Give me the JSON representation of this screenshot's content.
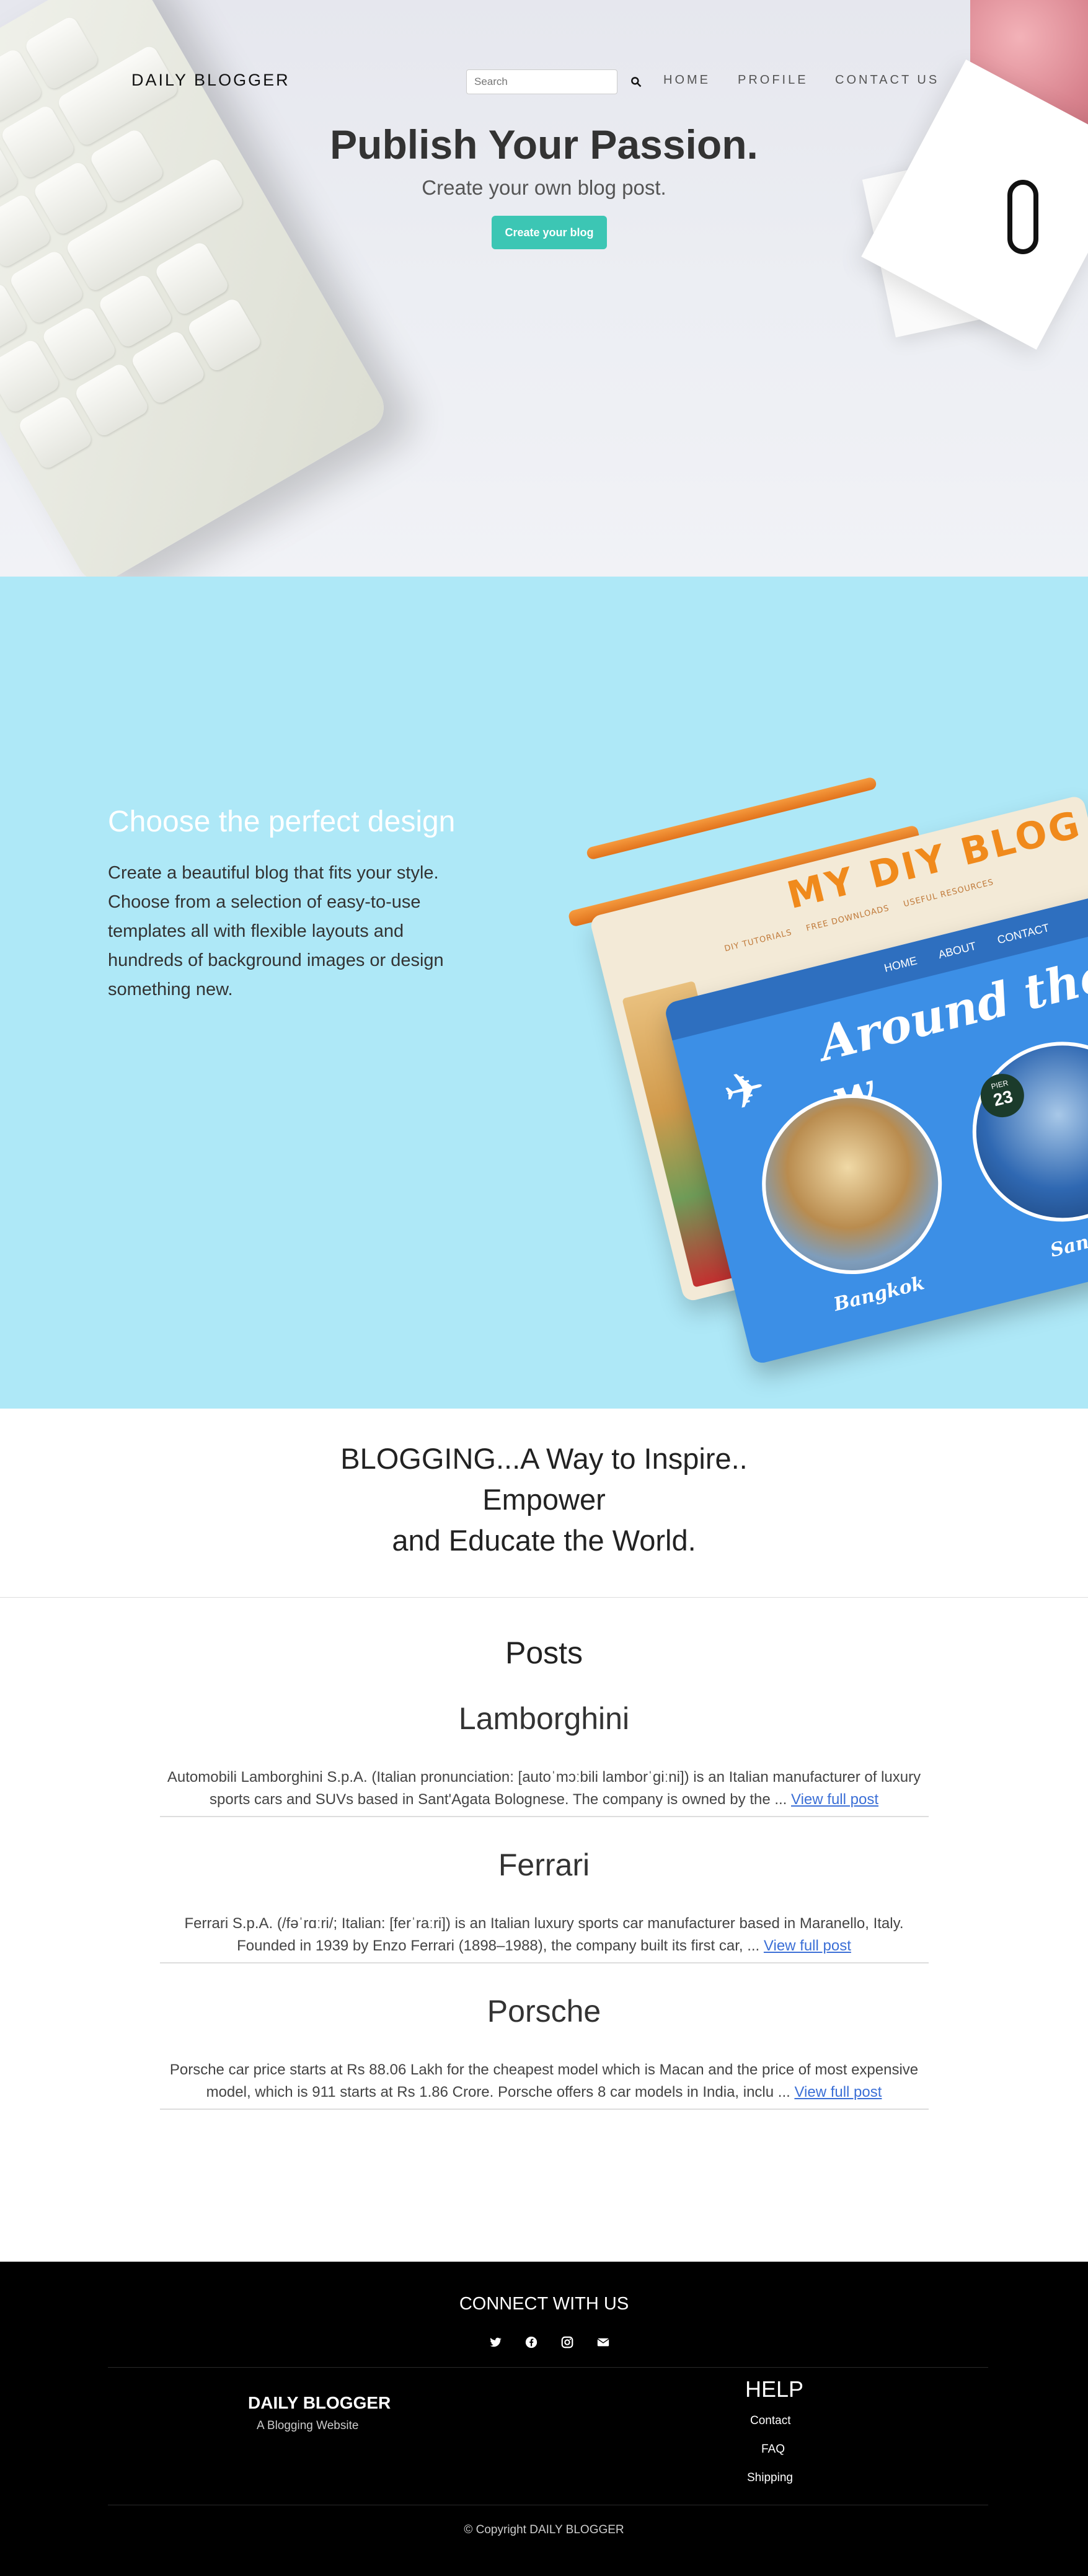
{
  "nav": {
    "brand": "DAILY BLOGGER",
    "search_placeholder": "Search",
    "links": [
      "HOME",
      "PROFILE",
      "CONTACT US"
    ]
  },
  "hero": {
    "title": "Publish Your Passion.",
    "subtitle": "Create your own blog post.",
    "button": "Create your blog"
  },
  "design": {
    "heading": "Choose the perfect design",
    "text": "Create a beautiful blog that fits your style. Choose from a selection of easy-to-use templates all with flexible layouts and hundreds of background images or design something new.",
    "art": {
      "blog_title": "MY DIY BLOG",
      "menu": [
        "DIY TUTORIALS",
        "FREE DOWNLOADS",
        "USEFUL RESOURCES"
      ],
      "nav": [
        "HOME",
        "ABOUT",
        "CONTACT"
      ],
      "headline": "Around the w",
      "place1": "Bangkok",
      "place2": "Sanfrancis",
      "pier": "PIER",
      "pier_num": "23"
    }
  },
  "slogan": {
    "line1": "BLOGGING...A Way to Inspire..",
    "line2": "Empower",
    "line3": "and Educate the World."
  },
  "posts": {
    "title": "Posts",
    "link_label": "View full post",
    "items": [
      {
        "title": "Lamborghini",
        "body": "Automobili Lamborghini S.p.A. (Italian pronunciation: [autoˈmɔːbili lamborˈɡiːni]) is an Italian manufacturer of luxury sports cars and SUVs based in Sant'Agata Bolognese. The company is owned by the ... "
      },
      {
        "title": "Ferrari",
        "body": "Ferrari S.p.A. (/fəˈrɑːri/; Italian: [ferˈraːri]) is an Italian luxury sports car manufacturer based in Maranello, Italy. Founded in 1939 by Enzo Ferrari (1898–1988), the company built its first car, ... "
      },
      {
        "title": "Porsche",
        "body": "Porsche car price starts at Rs 88.06 Lakh for the cheapest model which is Macan and the price of most expensive model, which is 911 starts at Rs 1.86 Crore. Porsche offers 8 car models in India, inclu ... "
      }
    ]
  },
  "footer": {
    "connect": "CONNECT WITH US",
    "brand": "DAILY BLOGGER",
    "tagline": "A Blogging Website",
    "help_title": "HELP",
    "help_links": [
      "Contact",
      "FAQ",
      "Shipping"
    ],
    "copyright": "© Copyright DAILY BLOGGER",
    "social_icons": [
      "twitter-icon",
      "facebook-icon",
      "instagram-icon",
      "envelope-icon"
    ]
  },
  "colors": {
    "accent": "#3cc6b4",
    "design_bg": "#aee8f7",
    "link": "#3b6fd6",
    "footer_bg": "#000000"
  }
}
